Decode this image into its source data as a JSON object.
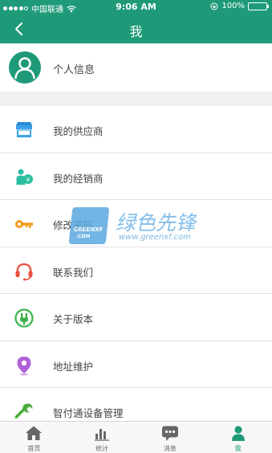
{
  "status_bar": {
    "carrier": "中国联通",
    "time": "9:06 AM",
    "battery": "100%",
    "battery_level": 1.0
  },
  "nav": {
    "title": "我"
  },
  "profile": {
    "label": "个人信息"
  },
  "menu": {
    "items": [
      {
        "label": "我的供应商",
        "icon": "store-icon"
      },
      {
        "label": "我的经销商",
        "icon": "dealer-icon"
      },
      {
        "label": "修改密码",
        "icon": "key-icon"
      },
      {
        "label": "联系我们",
        "icon": "headset-icon"
      },
      {
        "label": "关于版本",
        "icon": "version-icon"
      },
      {
        "label": "地址维护",
        "icon": "location-pin-icon"
      },
      {
        "label": "智付通设备管理",
        "icon": "wrench-icon"
      }
    ]
  },
  "watermark": {
    "badge_top": "GREENXF",
    "badge_bottom": ".COM",
    "name": "绿色先锋",
    "url": "www.greenxf.com"
  },
  "tabs": [
    {
      "label": "首页",
      "icon": "home-icon",
      "active": false
    },
    {
      "label": "统计",
      "icon": "stats-icon",
      "active": false
    },
    {
      "label": "消息",
      "icon": "message-icon",
      "active": false
    },
    {
      "label": "我",
      "icon": "person-icon",
      "active": true
    }
  ],
  "colors": {
    "primary": "#1e9a79",
    "store_blue": "#3aa0e8",
    "dealer_teal": "#2bbfa0",
    "key_orange": "#f39a1e",
    "headset_red": "#ea4f3c",
    "version_green": "#3db24b",
    "pin_purple": "#b061d8",
    "wrench_green": "#4caa3b"
  }
}
